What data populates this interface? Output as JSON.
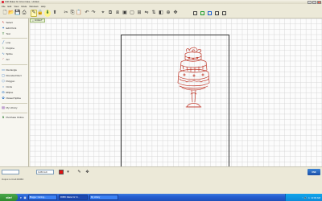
{
  "window": {
    "title": "KNK Maker for Cricut Cake - Untitled",
    "min_glyph": "–",
    "max_glyph": "□",
    "close_glyph": "×"
  },
  "menu": [
    "File",
    "Edit",
    "View",
    "Mode",
    "Windows",
    "Help"
  ],
  "toolbar": {
    "buttons": [
      {
        "name": "new-file-icon",
        "glyph": "🗋"
      },
      {
        "name": "open-folder-icon",
        "glyph": "📂"
      },
      {
        "name": "save-icon",
        "glyph": "💾"
      },
      {
        "name": "print-icon",
        "glyph": "⎙"
      },
      {
        "name": "cut-icon",
        "glyph": "✂"
      },
      {
        "name": "copy-icon",
        "glyph": "⎘"
      },
      {
        "name": "paste-icon",
        "glyph": "📋"
      },
      {
        "name": "undo-icon",
        "glyph": "↶"
      },
      {
        "name": "redo-icon",
        "glyph": "↷"
      }
    ],
    "mode_buttons": [
      {
        "name": "cut-mode-icon",
        "glyph": "✎"
      },
      {
        "name": "lock-icon",
        "glyph": "🔒"
      },
      {
        "name": "tool-3-icon",
        "glyph": "⬇"
      },
      {
        "name": "tool-4-icon",
        "glyph": "⬆"
      }
    ],
    "shape_buttons": [
      {
        "name": "node-tool-icon",
        "glyph": "⌖"
      },
      {
        "name": "weld-icon",
        "glyph": "⧉"
      },
      {
        "name": "break-icon",
        "glyph": "⧈"
      },
      {
        "name": "group-icon",
        "glyph": "▣"
      },
      {
        "name": "ungroup-icon",
        "glyph": "▢"
      },
      {
        "name": "align-icon",
        "glyph": "⊞"
      },
      {
        "name": "flip-icon",
        "glyph": "⇋"
      },
      {
        "name": "mirror-icon",
        "glyph": "⇅"
      },
      {
        "name": "shadow-icon",
        "glyph": "◧"
      },
      {
        "name": "zoom-icon",
        "glyph": "⊕"
      },
      {
        "name": "pan-icon",
        "glyph": "✥"
      }
    ]
  },
  "document_tab": {
    "label": "Untitled*",
    "close": "×"
  },
  "sidebar": {
    "items": [
      {
        "name": "select",
        "label": "Select",
        "glyph": "↖",
        "color": "#c62828"
      },
      {
        "name": "edit-points",
        "label": "Edit Point",
        "glyph": "✦",
        "color": "#1565c0"
      },
      {
        "name": "text",
        "label": "Text",
        "glyph": "T",
        "color": "#2e7d32"
      },
      {
        "name": "line",
        "label": "Line",
        "glyph": "╱",
        "color": "#1565c0"
      },
      {
        "name": "polyline",
        "label": "Polyline",
        "glyph": "⌇",
        "color": "#2e7d32"
      },
      {
        "name": "spline",
        "label": "Spline",
        "glyph": "∿",
        "color": "#1565c0"
      },
      {
        "name": "arc",
        "label": "Arc",
        "glyph": "◜",
        "color": "#c62828"
      },
      {
        "name": "rectangle",
        "label": "Rectangle",
        "glyph": "▭",
        "color": "#1565c0"
      },
      {
        "name": "rounded-rect",
        "label": "Rounded Rect",
        "glyph": "▢",
        "color": "#1565c0"
      },
      {
        "name": "polygon",
        "label": "Polygon",
        "glyph": "⬡",
        "color": "#1565c0"
      },
      {
        "name": "circle",
        "label": "Circle",
        "glyph": "○",
        "color": "#1565c0"
      },
      {
        "name": "ellipse",
        "label": "Ellipse",
        "glyph": "⬭",
        "color": "#1565c0"
      },
      {
        "name": "closed-spline",
        "label": "Closed Spline",
        "glyph": "✿",
        "color": "#1565c0"
      },
      {
        "name": "my-library",
        "label": "My Library",
        "glyph": "▤",
        "color": "#6a1b9a"
      },
      {
        "name": "purchase-online",
        "label": "Purchase Online",
        "glyph": "$",
        "color": "#2e7d32"
      }
    ]
  },
  "statusbar": {
    "field1": "",
    "field2": "0.283 inch",
    "swatch_color": "#e11111",
    "logo": "KNK"
  },
  "infobar": {
    "text": "Output to Craft ROBO"
  },
  "taskbar": {
    "start": "start",
    "tasks": [
      {
        "label": "Blogger: Coming..."
      },
      {
        "label": "ROBO Master for Cr..."
      },
      {
        "label": "My Library"
      }
    ],
    "tray_glyphs": [
      "◔",
      "🔊",
      "⚠"
    ],
    "clock": "12:00 AM"
  }
}
